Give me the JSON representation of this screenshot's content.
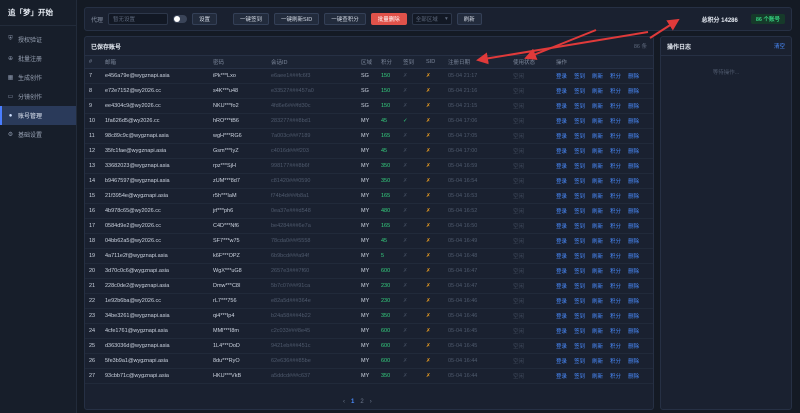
{
  "app": {
    "title": "追「梦」开始"
  },
  "sidebar": {
    "items": [
      {
        "label": "授权验证",
        "icon": "shield-icon"
      },
      {
        "label": "批量注册",
        "icon": "user-add-icon"
      },
      {
        "label": "生成创作",
        "icon": "grid-icon"
      },
      {
        "label": "分镜创作",
        "icon": "film-icon"
      },
      {
        "label": "账号管理",
        "icon": "user-icon",
        "active": true
      },
      {
        "label": "基础设置",
        "icon": "gear-icon"
      }
    ]
  },
  "toolbar": {
    "proxy_label": "代理",
    "proxy_placeholder": "暂无设置",
    "set_button": "设置",
    "sign_all": "一键签到",
    "refresh_sid": "一键刷新SID",
    "check_points": "一键查积分",
    "batch_delete": "批量删除",
    "region_select": "全部区域",
    "refresh": "刷新",
    "total_points": "总积分 14286",
    "account_count": "86 个账号"
  },
  "panel": {
    "title": "已保存账号",
    "count": "86 条",
    "columns": [
      "#",
      "邮箱",
      "密码",
      "会话ID",
      "区域",
      "积分",
      "签到",
      "SID",
      "注册日期",
      "使用状态",
      "操作"
    ],
    "row_actions": [
      "登录",
      "签到",
      "刷新",
      "积分",
      "删除"
    ],
    "rows": [
      [
        "7",
        "e456a79e@wygznapi.asia",
        "iPk***Lxo",
        "e6aee1###fc6f3",
        "SG",
        "150",
        "✗",
        "✗",
        "05-04 21:17",
        "空闲"
      ],
      [
        "8",
        "e72e7152@wy2026.cc",
        "s4K***u48",
        "e33527###457a0",
        "SG",
        "150",
        "✗",
        "✗",
        "05-04 21:16",
        "空闲"
      ],
      [
        "9",
        "ee4304c9@wy2026.cc",
        "NKU***fo2",
        "4fd6e6###fd30c",
        "SG",
        "150",
        "✗",
        "✗",
        "05-04 21:15",
        "空闲"
      ],
      [
        "10",
        "1fa626d5@wy2026.cc",
        "hRO***tB6",
        "283277###8bd1",
        "MY",
        "45",
        "✓",
        "✗",
        "05-04 17:06",
        "空闲"
      ],
      [
        "11",
        "98c89c9c@wygznapi.asia",
        "wgH***RG6",
        "7a003c###7189",
        "MY",
        "165",
        "✗",
        "✗",
        "05-04 17:05",
        "空闲"
      ],
      [
        "12",
        "35fc1fae@wygznapi.asia",
        "Gsm***IyZ",
        "c4016d###f203",
        "MY",
        "45",
        "✗",
        "✗",
        "05-04 17:00",
        "空闲"
      ],
      [
        "13",
        "33682023@wygznapi.asia",
        "rpz***SjH",
        "998177###8b6f",
        "MY",
        "350",
        "✗",
        "✗",
        "05-04 16:59",
        "空闲"
      ],
      [
        "14",
        "b9467597@wygznapi.asia",
        "zUM***8d7",
        "c81420###0590",
        "MY",
        "350",
        "✗",
        "✗",
        "05-04 16:54",
        "空闲"
      ],
      [
        "15",
        "21f3954e@wygznapi.asia",
        "r5h***IaM",
        "f74b4d###b8a1",
        "MY",
        "165",
        "✗",
        "✗",
        "05-04 16:53",
        "空闲"
      ],
      [
        "16",
        "4b978c65@wy2026.cc",
        "jrf***ph6",
        "0ea37e###d548",
        "MY",
        "480",
        "✗",
        "✗",
        "05-04 16:52",
        "空闲"
      ],
      [
        "17",
        "0584d9e2@wy2026.cc",
        "C4D***Nf6",
        "be4284###6e7a",
        "MY",
        "165",
        "✗",
        "✗",
        "05-04 16:50",
        "空闲"
      ],
      [
        "18",
        "04bb62a5@wy2026.cc",
        "SF7***w75",
        "78cda0###5558",
        "MY",
        "45",
        "✗",
        "✗",
        "05-04 16:49",
        "空闲"
      ],
      [
        "19",
        "4a711e2f@wygznapi.asia",
        "k6F***OPZ",
        "6b9bcd###a94f",
        "MY",
        "5",
        "✗",
        "✗",
        "05-04 16:48",
        "空闲"
      ],
      [
        "20",
        "3d70c0c6@wygznapi.asia",
        "WgX***uG8",
        "2657e3###7f60",
        "MY",
        "600",
        "✗",
        "✗",
        "05-04 16:47",
        "空闲"
      ],
      [
        "21",
        "228c0de2@wygznapi.asia",
        "Dmw***C8I",
        "5b7c07###91ca",
        "MY",
        "230",
        "✗",
        "✗",
        "05-04 16:47",
        "空闲"
      ],
      [
        "22",
        "1e92b6ba@wy2026.cc",
        "rL7***756",
        "e82a5d###364e",
        "MY",
        "230",
        "✗",
        "✗",
        "05-04 16:46",
        "空闲"
      ],
      [
        "23",
        "34be3261@wygznapi.asia",
        "qi4***Ip4",
        "b24a58###4b22",
        "MY",
        "350",
        "✗",
        "✗",
        "05-04 16:46",
        "空闲"
      ],
      [
        "24",
        "4cfe1761@wygznapi.asia",
        "MMl***I8m",
        "c2c033###8e45",
        "MY",
        "600",
        "✗",
        "✗",
        "05-04 16:45",
        "空闲"
      ],
      [
        "25",
        "d363036d@wygznapi.asia",
        "1L4***OoD",
        "9421eb###451c",
        "MY",
        "600",
        "✗",
        "✗",
        "05-04 16:45",
        "空闲"
      ],
      [
        "26",
        "5fe3b9a1@wygznapi.asia",
        "8du***RyO",
        "62e636###85be",
        "MY",
        "600",
        "✗",
        "✗",
        "05-04 16:44",
        "空闲"
      ],
      [
        "27",
        "93cbb71c@wygznapi.asia",
        "HKU***VkB",
        "a5ddcd###c637",
        "MY",
        "350",
        "✗",
        "✗",
        "05-04 16:44",
        "空闲"
      ]
    ]
  },
  "pager": {
    "prev": "‹",
    "pages": [
      "1",
      "2"
    ],
    "next": "›"
  },
  "log": {
    "title": "操作日志",
    "clear": "清空",
    "empty": "等待操作..."
  },
  "colors": {
    "accent": "#4a8cff",
    "danger": "#e0524a",
    "success": "#35d07f",
    "warning": "#f0a020"
  }
}
